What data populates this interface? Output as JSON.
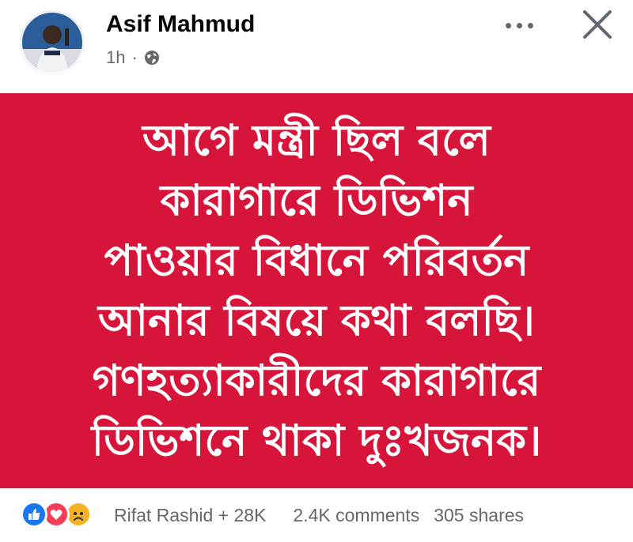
{
  "post": {
    "author": "Asif Mahmud",
    "time": "1h",
    "separator": "·",
    "privacy_icon": "globe-icon",
    "more_icon": "more-horizontal-icon",
    "close_icon": "close-icon"
  },
  "image_text": {
    "lines": [
      "আগে মন্ত্রী ছিল বলে",
      "কারাগারে ডিভিশন",
      "পাওয়ার বিধানে পরিবর্তন",
      "আনার বিষয়ে কথা বলছি।",
      "গণহত্যাকারীদের কারাগারে",
      "ডিভিশনে থাকা দুঃখজনক।"
    ],
    "background_color": "#d7153a",
    "text_color": "#ffffff"
  },
  "footer": {
    "reaction_icons": [
      "like-icon",
      "love-icon",
      "sad-icon"
    ],
    "reacted_by": "Rifat Rashid + 28K",
    "comments": "2.4K comments",
    "shares": "305 shares"
  }
}
